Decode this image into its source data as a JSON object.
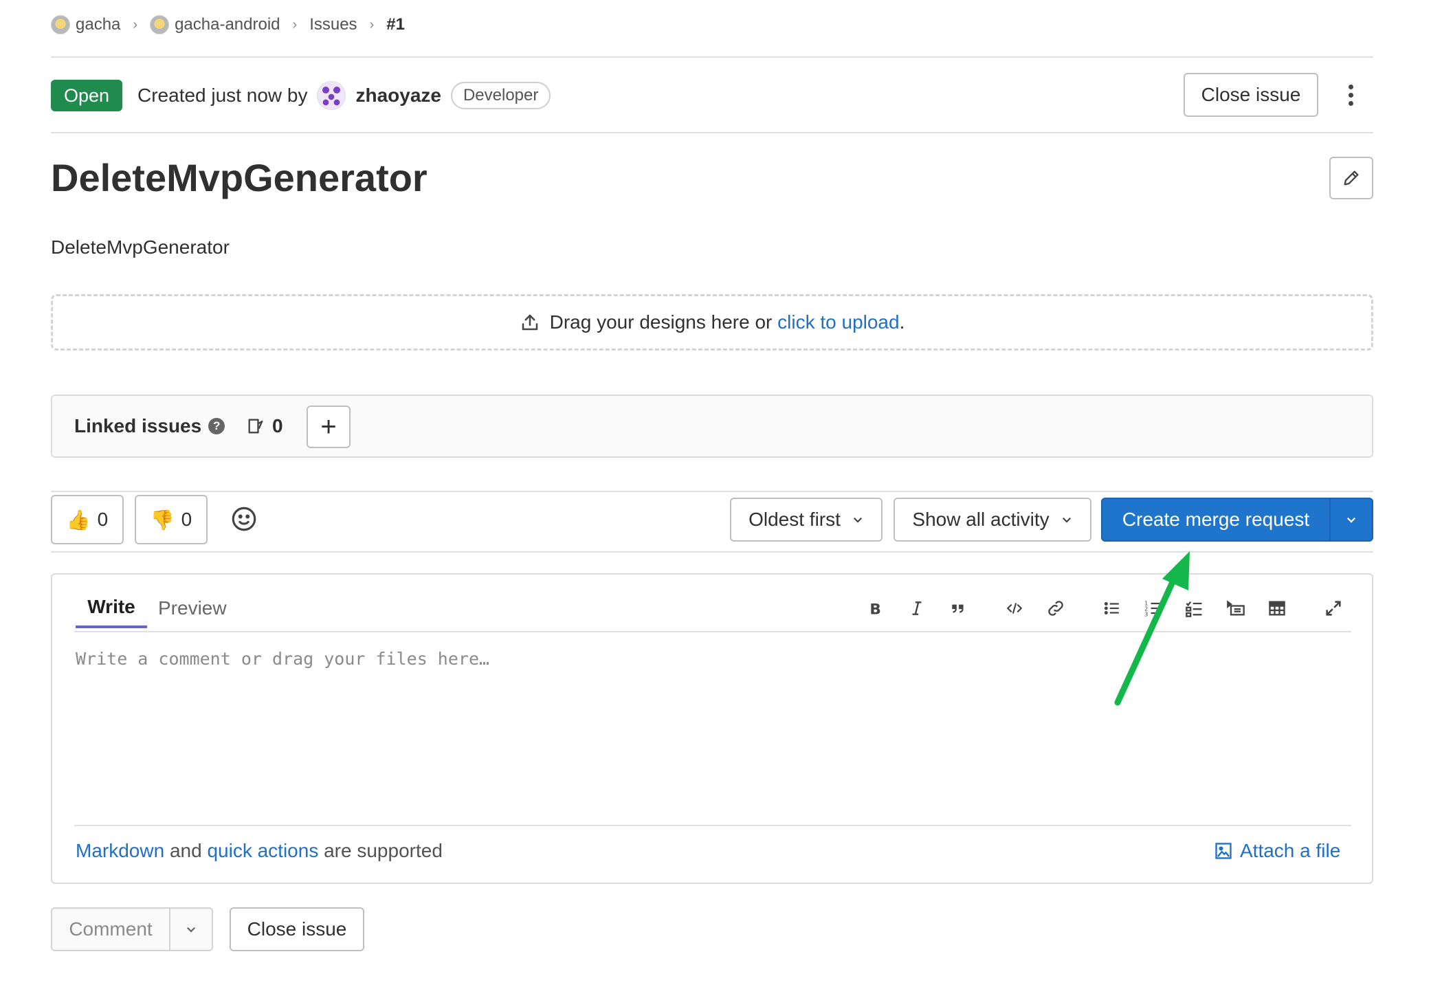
{
  "breadcrumb": {
    "items": [
      "gacha",
      "gacha-android",
      "Issues",
      "#1"
    ],
    "separator": "›"
  },
  "issue": {
    "status": "Open",
    "created_text": "Created just now by",
    "author": "zhaoyaze",
    "role": "Developer",
    "close_label": "Close issue",
    "title": "DeleteMvpGenerator",
    "description": "DeleteMvpGenerator"
  },
  "design_upload": {
    "text": "Drag your designs here or",
    "link": "click to upload",
    "suffix": "."
  },
  "linked_issues": {
    "title": "Linked issues",
    "help": "?",
    "count": "0",
    "add": "+"
  },
  "reactions": {
    "thumbs_up_count": "0",
    "thumbs_down_count": "0"
  },
  "activity": {
    "sort_label": "Oldest first",
    "filter_label": "Show all activity",
    "merge_request_label": "Create merge request"
  },
  "editor": {
    "tabs": [
      "Write",
      "Preview"
    ],
    "placeholder": "Write a comment or drag your files here…",
    "markdown_link": "Markdown",
    "and_text": "and",
    "quick_actions_link": "quick actions",
    "supported_text": "are supported",
    "attach_label": "Attach a file"
  },
  "actions": {
    "comment_label": "Comment",
    "close_label": "Close issue"
  },
  "colors": {
    "open_badge": "#1f8b4c",
    "primary": "#1f75cb",
    "link": "#1f6fc5",
    "annotation_arrow": "#14b84a"
  },
  "icons": {
    "upload": "upload-icon",
    "edit": "pencil-icon",
    "issues": "issues-icon",
    "emoji": "smiley-icon",
    "chevron": "chevron-down-icon"
  }
}
